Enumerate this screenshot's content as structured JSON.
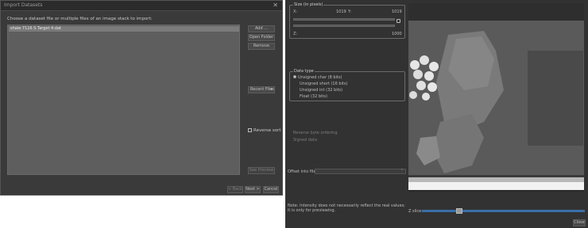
{
  "import_dialog": {
    "title": "Import Datasets",
    "close_glyph": "✕",
    "instruction": "Choose a dataset file or multiple files of an image stack to import:",
    "files": [
      "shale 7116 S Target 4.dat"
    ],
    "buttons": {
      "add": "Add ...",
      "open_folder": "Open Folder ...",
      "remove": "Remove",
      "recent_files": "Recent Files",
      "see_preview": "See Preview",
      "back": "< Back",
      "next": "Next >",
      "cancel": "Cancel"
    },
    "reverse_sort_label": "Reverse sort"
  },
  "raw_panel": {
    "size_group": {
      "title": "Size (in pixels)",
      "x_label": "X:",
      "x_value": "1019",
      "y_label": "Y:",
      "y_value": "1019",
      "z_label": "Z:",
      "z_value": "1000"
    },
    "data_type_group": {
      "title": "Data type",
      "options": [
        "Unsigned char (8 bits)",
        "Unsigned short (16 bits)",
        "Unsigned int (32 bits)",
        "Float (32 bits)"
      ]
    },
    "reverse_byte_ordering": "Reverse byte ordering",
    "signed_data": "Signed data",
    "offset_label": "Offset into file:",
    "note": "Note: Intensity does not necessarily reflect the real values; it is only for previewing.",
    "z_slice_label": "Z slice:",
    "close_button": "Close"
  },
  "colors": {
    "dialog_bg": "#3a3a3a",
    "panel_bg": "#323232",
    "accent": "#3a6fa8"
  }
}
